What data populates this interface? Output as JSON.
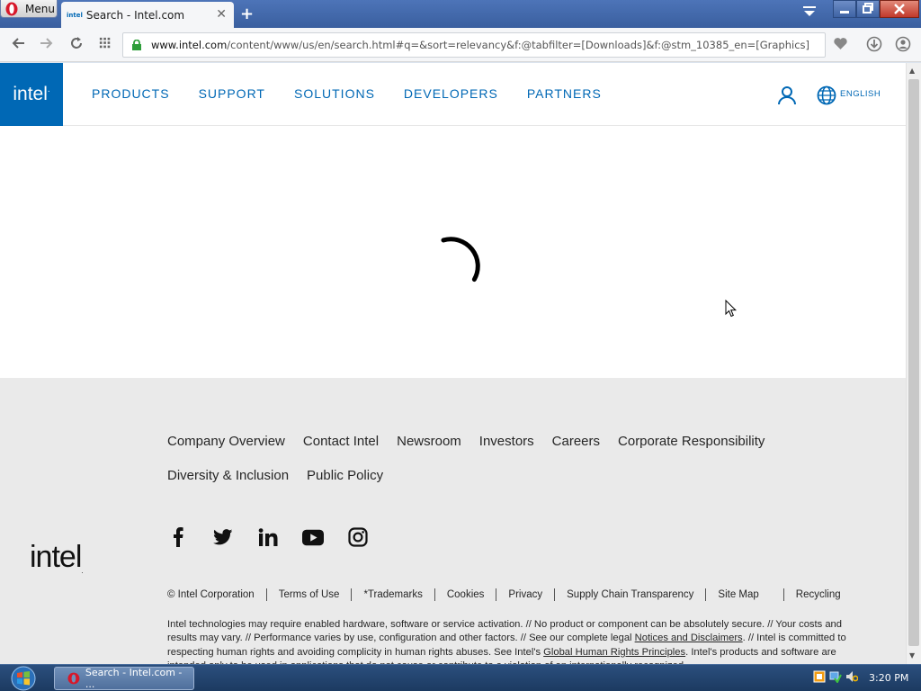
{
  "browser": {
    "menu_label": "Menu",
    "tab_title": "Search - Intel.com",
    "tab_favicon_text": "intel",
    "url_host": "www.intel.com",
    "url_path": "/content/www/us/en/search.html#q=&sort=relevancy&f:@tabfilter=[Downloads]&f:@stm_10385_en=[Graphics]"
  },
  "header": {
    "logo": "intel",
    "nav": [
      "PRODUCTS",
      "SUPPORT",
      "SOLUTIONS",
      "DEVELOPERS",
      "PARTNERS"
    ],
    "language": "ENGLISH"
  },
  "footer": {
    "links": [
      "Company Overview",
      "Contact Intel",
      "Newsroom",
      "Investors",
      "Careers",
      "Corporate Responsibility",
      "Diversity & Inclusion",
      "Public Policy"
    ],
    "social": [
      "facebook-icon",
      "twitter-icon",
      "linkedin-icon",
      "youtube-icon",
      "instagram-icon"
    ],
    "logo": "intel",
    "legal_links": [
      "© Intel Corporation",
      "Terms of Use",
      "*Trademarks",
      "Cookies",
      "Privacy",
      "Supply Chain Transparency",
      "Site Map",
      "Recycling"
    ],
    "legal_text_1": "Intel technologies may require enabled hardware, software or service activation. // No product or component can be absolutely secure. // Your costs and results may vary. // Performance varies by use, configuration and other factors. // See our complete legal ",
    "legal_link_notices": "Notices and Disclaimers",
    "legal_text_2": ". // Intel is committed to respecting human rights and avoiding complicity in human rights abuses. See Intel's ",
    "legal_link_human_rights": "Global Human Rights Principles",
    "legal_text_3": ". Intel's products and software are intended only to be used in applications that do not cause or contribute to a violation of an internationally recognized"
  },
  "taskbar": {
    "task_label": "Search - Intel.com - ...",
    "clock": "3:20 PM"
  },
  "colors": {
    "intel_blue": "#0068b5",
    "footer_bg": "#eaeaea"
  }
}
